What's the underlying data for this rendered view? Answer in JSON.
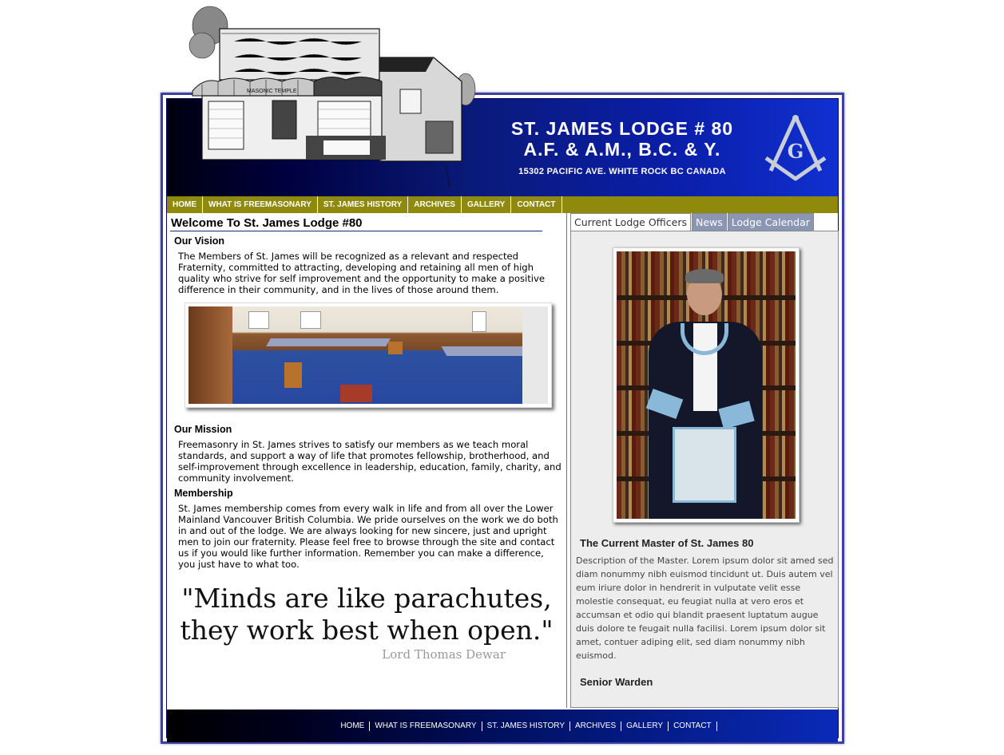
{
  "header": {
    "title_line1": "ST. JAMES LODGE # 80",
    "title_line2": "A.F. & A.M., B.C. & Y.",
    "address": "15302 PACIFIC AVE. WHITE ROCK BC CANADA",
    "emblem_letter": "G",
    "building_sign": "MASONIC TEMPLE"
  },
  "nav": {
    "items": [
      "HOME",
      "WHAT IS FREEMASONARY",
      "ST. JAMES HISTORY",
      "ARCHIVES",
      "GALLERY",
      "CONTACT"
    ]
  },
  "main": {
    "title": "Welcome To St. James Lodge #80",
    "vision": {
      "heading": "Our Vision",
      "text": "The Members of St. James will be recognized as a relevant and respected Fraternity, committed to attracting, developing and retaining all men of high quality who strive for self improvement and the opportunity to make a positive difference in their community, and in the lives of those around them."
    },
    "mission": {
      "heading": "Our Mission",
      "text": "Freemasonry in St. James strives to satisfy our members as we teach moral standards, and support a way of life that promotes fellowship, brotherhood, and self-improvement through excellence in leadership, education, family, charity, and community involvement."
    },
    "membership": {
      "heading": "Membership",
      "text": "St. James membership comes from every walk in life and from all over the Lower Mainland Vancouver British Columbia. We pride ourselves on the work we do both in and out of the lodge. We are always looking for new sincere, just and upright men to join our fraternity. Please feel free to browse through the site and contact us if you would like further information. Remember you can make a difference, you just have to what too."
    },
    "quote": {
      "line1": "\"Minds are like parachutes,",
      "line2": "they work best when open.\"",
      "author": "Lord Thomas Dewar"
    }
  },
  "sidebar": {
    "tabs": [
      "Current Lodge Officers",
      "News",
      "Lodge Calendar"
    ],
    "active_tab": "Current Lodge Officers",
    "officer_title": "The Current Master of St. James 80",
    "officer_desc": "Description of the Master. Lorem ipsum dolor sit amed sed diam nonummy nibh euismod tincidunt ut. Duis autem vel eum iriure dolor in hendrerit in vulputate velit esse molestie consequat, eu feugiat nulla at vero eros et accumsan et odio qui blandit praesent luptatum augue duis dolore te feugait nulla facilisi. Lorem ipsum dolor sit amet, contuer adiping elit, sed diam nonummy nibh euismod.",
    "officer2_title": "Senior Warden"
  },
  "footer": {
    "links": [
      "HOME",
      "WHAT IS FREEMASONARY",
      "ST. JAMES HISTORY",
      "ARCHIVES",
      "GALLERY",
      "CONTACT"
    ]
  },
  "colors": {
    "nav_bg": "#8f8a0c",
    "header_blue": "#0a1ea8",
    "tab_inactive": "#8a96b4",
    "panel_bg": "#ededed"
  }
}
